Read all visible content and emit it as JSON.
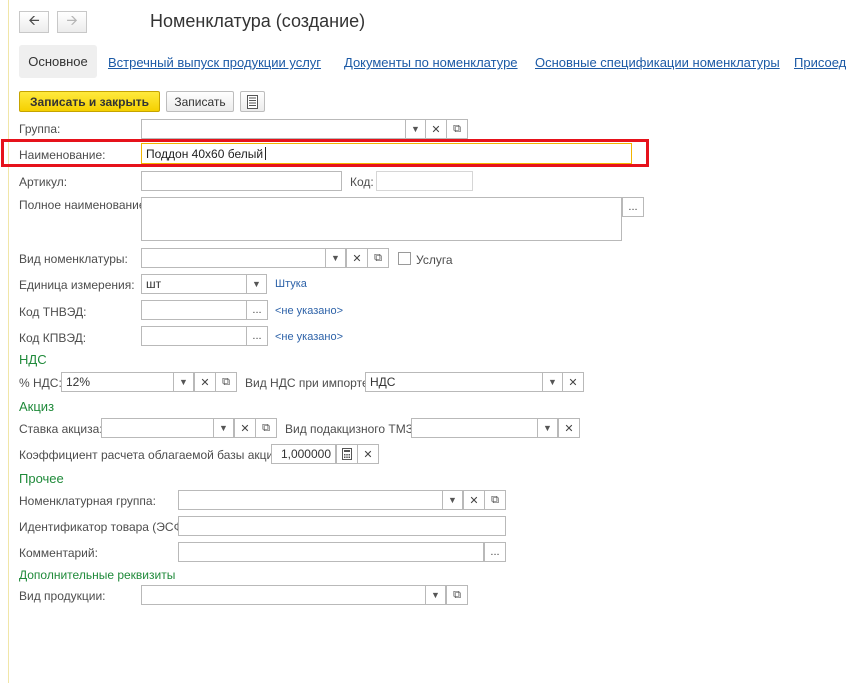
{
  "window": {
    "title": "Номенклатура (создание)"
  },
  "nav": {
    "back_icon": "arrow-left-icon",
    "forward_icon": "arrow-right-icon"
  },
  "tabs": [
    {
      "label": "Основное",
      "active": true
    },
    {
      "label": "Встречный выпуск продукции услуг"
    },
    {
      "label": "Документы по номенклатуре"
    },
    {
      "label": "Основные спецификации номенклатуры"
    },
    {
      "label": "Присоед"
    }
  ],
  "toolbar": {
    "save_close_label": "Записать и закрыть",
    "save_label": "Записать",
    "report_icon": "document-list-icon"
  },
  "form": {
    "group_label": "Группа:",
    "group_value": "",
    "name_label": "Наименование:",
    "name_value": "Поддон 40х60 белый",
    "article_label": "Артикул:",
    "article_value": "",
    "code_label": "Код:",
    "code_value": "",
    "full_name_label": "Полное наименование:",
    "full_name_value": "",
    "kind_label": "Вид номенклатуры:",
    "kind_value": "",
    "service_label": "Услуга",
    "service_checked": false,
    "unit_label": "Единица измерения:",
    "unit_value": "шт",
    "unit_link": "Штука",
    "tnved_label": "Код ТНВЭД:",
    "tnved_value": "",
    "tnved_link": "<не указано>",
    "kpved_label": "Код КПВЭД:",
    "kpved_value": "",
    "kpved_link": "<не указано>"
  },
  "vat": {
    "section_title": "НДС",
    "rate_label": "% НДС:",
    "rate_value": "12%",
    "import_label": "Вид НДС при импорте:",
    "import_value": "НДС"
  },
  "excise": {
    "section_title": "Акциз",
    "rate_label": "Ставка акциза:",
    "rate_value": "",
    "goods_label": "Вид подакцизного ТМЗ:",
    "goods_value": "",
    "coef_label": "Коэффициент расчета облагаемой базы акциза:",
    "coef_value": "1,000000"
  },
  "other": {
    "section_title": "Прочее",
    "group_label": "Номенклатурная группа:",
    "group_value": "",
    "id_label": "Идентификатор товара (ЭСФ):",
    "id_value": "",
    "comment_label": "Комментарий:",
    "comment_value": ""
  },
  "extra": {
    "section_title": "Дополнительные реквизиты",
    "product_kind_label": "Вид продукции:",
    "product_kind_value": ""
  },
  "icons": {
    "dropdown": "chevron-down-icon",
    "clear": "clear-x-icon",
    "open": "open-form-icon",
    "select": "ellipsis-icon",
    "calculator": "calculator-icon"
  },
  "colors": {
    "primary_button": "#f5d000",
    "section_title": "#1f8a3a",
    "link": "#2d62a8",
    "annotation_frame": "#e6121b",
    "focus_border": "#f2b400"
  }
}
